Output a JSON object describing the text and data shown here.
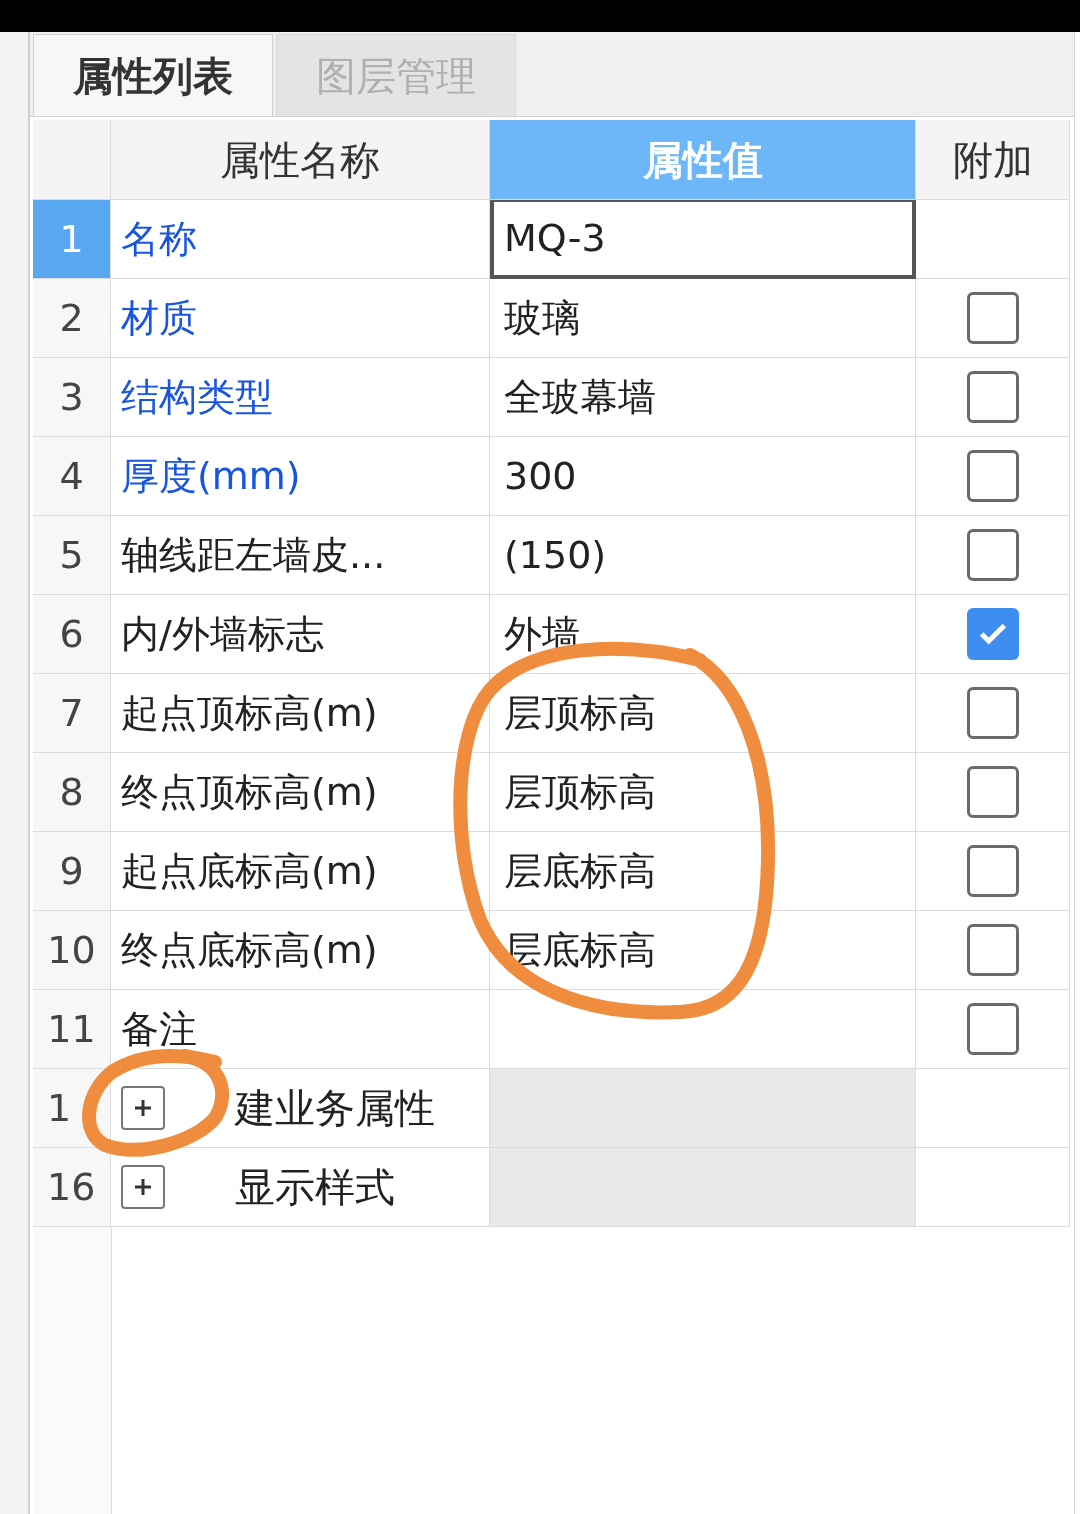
{
  "tabs": [
    {
      "label": "属性列表",
      "selected": true
    },
    {
      "label": "图层管理",
      "selected": false
    }
  ],
  "columns": [
    {
      "label": "属性名称",
      "selected": false
    },
    {
      "label": "属性值",
      "selected": true
    },
    {
      "label": "附加",
      "selected": false
    }
  ],
  "rows": [
    {
      "kind": "property",
      "number": "1",
      "name": "名称",
      "color": "#1a55e0",
      "value": "MQ-3",
      "selected": true
    },
    {
      "kind": "property",
      "number": "2",
      "name": "材质",
      "color": "#1a55e0",
      "value": "玻璃",
      "selected": false,
      "checked": false
    },
    {
      "kind": "property",
      "number": "3",
      "name": "结构类型",
      "color": "#1a55e0",
      "value": "全玻幕墙",
      "selected": false,
      "checked": false
    },
    {
      "kind": "property",
      "number": "4",
      "name": "厚度(mm)",
      "color": "#1a55e0",
      "value": "300",
      "selected": false,
      "checked": false
    },
    {
      "kind": "property",
      "number": "5",
      "name": "轴线距左墙皮...",
      "color": "#222222",
      "value": "(150)",
      "selected": false,
      "checked": false
    },
    {
      "kind": "property",
      "number": "6",
      "name": "内/外墙标志",
      "color": "#222222",
      "value": "外墙",
      "selected": false,
      "checked": true
    },
    {
      "kind": "property",
      "number": "7",
      "name": "起点顶标高(m)",
      "color": "#222222",
      "value": "层顶标高",
      "selected": false,
      "checked": false
    },
    {
      "kind": "property",
      "number": "8",
      "name": "终点顶标高(m)",
      "color": "#222222",
      "value": "层顶标高",
      "selected": false,
      "checked": false
    },
    {
      "kind": "property",
      "number": "9",
      "name": "起点底标高(m)",
      "color": "#222222",
      "value": "层底标高",
      "selected": false,
      "checked": false
    },
    {
      "kind": "property",
      "number": "10",
      "name": "终点底标高(m)",
      "color": "#222222",
      "value": "层底标高",
      "selected": false,
      "checked": false
    },
    {
      "kind": "property",
      "number": "11",
      "name": "备注",
      "color": "#222222",
      "selected": false,
      "checked": false
    },
    {
      "kind": "group",
      "number": "1",
      "name": "建业务属性",
      "expanded": false,
      "selected": false
    },
    {
      "kind": "group",
      "number": "16",
      "name": "显示样式",
      "expanded": false,
      "selected": false
    }
  ]
}
